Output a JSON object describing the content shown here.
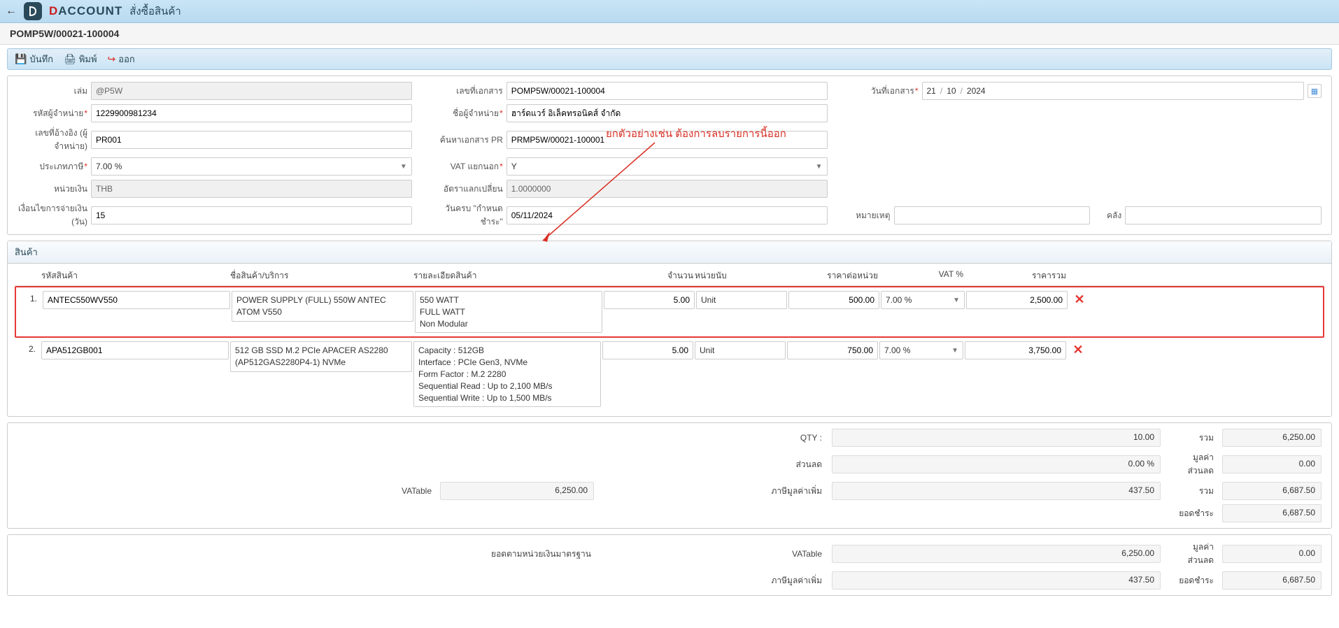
{
  "header": {
    "brand_prefix": "D",
    "brand_rest": "ACCOUNT",
    "page_title": "สั่งซื้อสินค้า"
  },
  "doc_id": "POMP5W/00021-100004",
  "toolbar": {
    "save": "บันทึก",
    "print": "พิมพ์",
    "exit": "ออก"
  },
  "form": {
    "book_label": "เล่ม",
    "book_value": "@P5W",
    "docno_label": "เลขที่เอกสาร",
    "docno_value": "POMP5W/00021-100004",
    "docdate_label": "วันที่เอกสาร",
    "docdate_d": "21",
    "docdate_m": "10",
    "docdate_y": "2024",
    "vendorcode_label": "รหัสผู้จำหน่าย",
    "vendorcode_value": "1229900981234",
    "vendorname_label": "ชื่อผู้จำหน่าย",
    "vendorname_value": "ฮาร์ดแวร์ อิเล็คทรอนิคส์ จำกัด",
    "ref_label": "เลขที่อ้างอิง (ผู้จำหน่าย)",
    "ref_value": "PR001",
    "pr_label": "ค้นหาเอกสาร PR",
    "pr_value": "PRMP5W/00021-100001",
    "taxtype_label": "ประเภทภาษี",
    "taxtype_value": "7.00 %",
    "vatout_label": "VAT แยกนอก",
    "vatout_value": "Y",
    "currency_label": "หน่วยเงิน",
    "currency_value": "THB",
    "rate_label": "อัตราแลกเปลี่ยน",
    "rate_value": "1.0000000",
    "terms_label": "เงื่อนไขการจ่ายเงิน (วัน)",
    "terms_value": "15",
    "due_label": "วันครบ \"กำหนดชำระ\"",
    "due_value": "05/11/2024",
    "note_label": "หมายเหตุ",
    "warehouse_label": "คลัง"
  },
  "annotation": "ยกตัวอย่างเช่น ต้องการลบรายการนี้ออก",
  "items": {
    "section_title": "สินค้า",
    "headers": {
      "code": "รหัสสินค้า",
      "name": "ชื่อสินค้า/บริการ",
      "detail": "รายละเอียดสินค้า",
      "qty": "จำนวน",
      "unit": "หน่วยนับ",
      "unitprice": "ราคาต่อหน่วย",
      "vat": "VAT %",
      "total": "ราคารวม"
    },
    "rows": [
      {
        "num": "1.",
        "code": "ANTEC550WV550",
        "name": "POWER SUPPLY (FULL) 550W ANTEC ATOM V550",
        "detail": "550 WATT\nFULL WATT\nNon Modular",
        "qty": "5.00",
        "unit": "Unit",
        "unitprice": "500.00",
        "vat": "7.00 %",
        "total": "2,500.00",
        "highlighted": true
      },
      {
        "num": "2.",
        "code": "APA512GB001",
        "name": "512 GB SSD M.2 PCIe APACER AS2280 (AP512GAS2280P4-1) NVMe",
        "detail": "Capacity : 512GB\nInterface : PCIe Gen3, NVMe\nForm Factor : M.2 2280\nSequential Read : Up to 2,100 MB/s\nSequential Write : Up to 1,500 MB/s",
        "qty": "5.00",
        "unit": "Unit",
        "unitprice": "750.00",
        "vat": "7.00 %",
        "total": "3,750.00",
        "highlighted": false
      }
    ]
  },
  "totals1": {
    "qty_label": "QTY :",
    "qty_value": "10.00",
    "sum_label": "รวม",
    "sum_value": "6,250.00",
    "discount_label": "ส่วนลด",
    "discount_value": "0.00 %",
    "discount_amt_label": "มูลค่าส่วนลด",
    "discount_amt_value": "0.00",
    "vatable_label": "VATable",
    "vatable_value": "6,250.00",
    "vat_label": "ภาษีมูลค่าเพิ่ม",
    "vat_value": "437.50",
    "sum2_label": "รวม",
    "sum2_value": "6,687.50",
    "due_label": "ยอดชำระ",
    "due_value": "6,687.50"
  },
  "totals2": {
    "base_label": "ยอดตามหน่วยเงินมาตรฐาน",
    "vatable_label": "VATable",
    "vatable_value": "6,250.00",
    "discount_amt_label": "มูลค่าส่วนลด",
    "discount_amt_value": "0.00",
    "vat_label": "ภาษีมูลค่าเพิ่ม",
    "vat_value": "437.50",
    "due_label": "ยอดชำระ",
    "due_value": "6,687.50"
  }
}
